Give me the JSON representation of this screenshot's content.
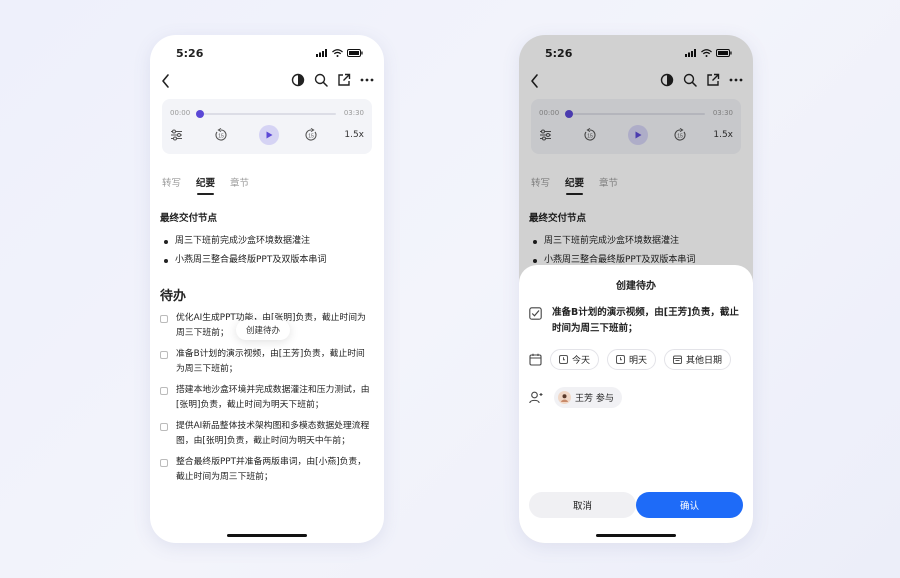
{
  "status": {
    "time": "5:26"
  },
  "player": {
    "current_time": "00:00",
    "total_time": "03:30",
    "progress": 0,
    "speed": "1.5x",
    "skip_back": "15",
    "skip_forward": "15"
  },
  "tabs": [
    "转写",
    "纪要",
    "章节"
  ],
  "active_tab": "纪要",
  "summary": {
    "section_title": "最终交付节点",
    "bullets": [
      "周三下班前完成沙盒环境数据灌注",
      "小燕周三整合最终版PPT及双版本串词"
    ]
  },
  "todo": {
    "title": "待办",
    "items": [
      "优化AI生成PPT功能，由[张明]负责，截止时间为周三下班前；",
      "准备B计划的演示视频，由[王芳]负责，截止时间为周三下班前；",
      "搭建本地沙盒环境并完成数据灌注和压力测试，由[张明]负责，截止时间为明天下班前；",
      "提供AI新品整体技术架构图和多模态数据处理流程图，由[张明]负责，截止时间为明天中午前；",
      "整合最终版PPT并准备两版串词，由[小燕]负责，截止时间为周三下班前；"
    ],
    "tooltip": "创建待办"
  },
  "sheet": {
    "title": "创建待办",
    "task": "准备B计划的演示视频，由[王芳]负责，截止时间为周三下班前；",
    "date_options": [
      "今天",
      "明天",
      "其他日期"
    ],
    "assignee": "王芳 参与",
    "cancel": "取消",
    "confirm": "确认"
  },
  "colors": {
    "accent": "#5b48d6",
    "confirm": "#1e6bf8"
  }
}
